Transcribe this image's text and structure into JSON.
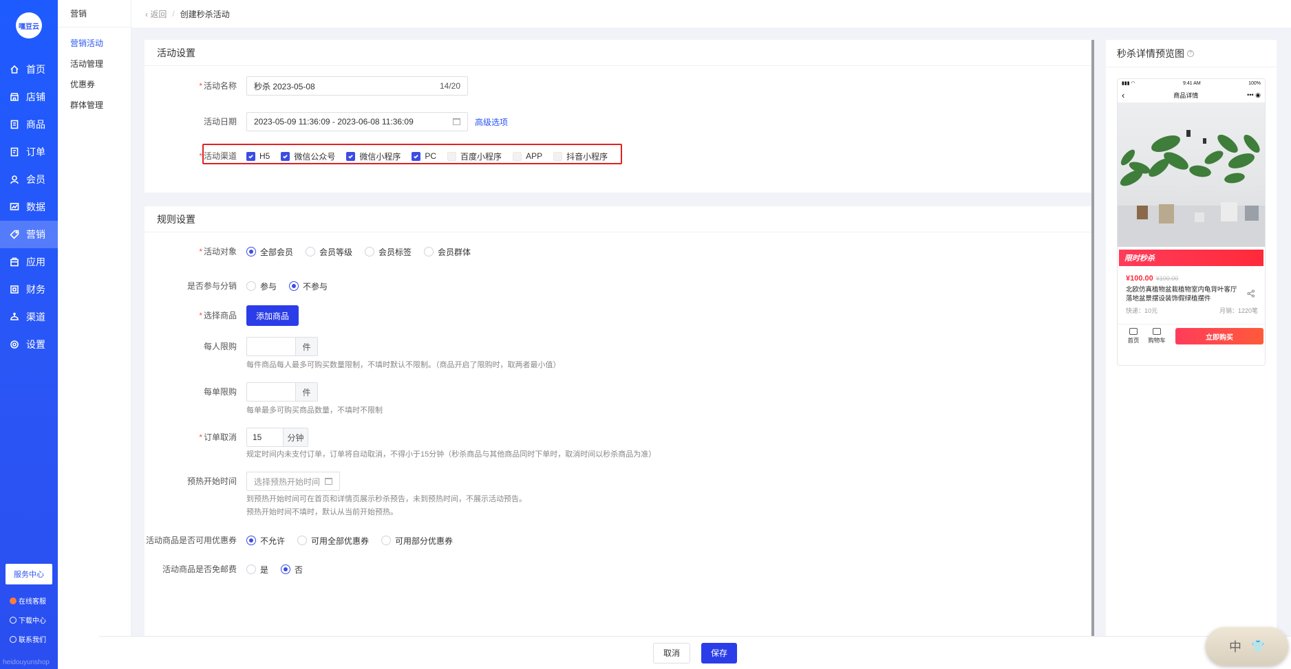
{
  "nav": {
    "logo": "嘿豆云",
    "items": [
      {
        "label": "首页",
        "icon": "home-icon"
      },
      {
        "label": "店铺",
        "icon": "store-icon"
      },
      {
        "label": "商品",
        "icon": "goods-icon"
      },
      {
        "label": "订单",
        "icon": "order-icon"
      },
      {
        "label": "会员",
        "icon": "member-icon"
      },
      {
        "label": "数据",
        "icon": "chart-icon"
      },
      {
        "label": "营销",
        "icon": "tag-icon"
      },
      {
        "label": "应用",
        "icon": "app-icon"
      },
      {
        "label": "财务",
        "icon": "finance-icon"
      },
      {
        "label": "渠道",
        "icon": "channel-icon"
      },
      {
        "label": "设置",
        "icon": "gear-icon"
      }
    ],
    "service_center": "服务中心",
    "online_service": "在线客服",
    "download_center": "下载中心",
    "contact_us": "联系我们",
    "footer_text": "heidouyunshop"
  },
  "submenu": {
    "title": "营销",
    "items": [
      "营销活动",
      "活动管理",
      "优惠券",
      "群体管理"
    ]
  },
  "breadcrumb": {
    "back": "返回",
    "separator": "/",
    "current": "创建秒杀活动"
  },
  "activity_settings": {
    "title": "活动设置",
    "name_label": "活动名称",
    "name_value": "秒杀  2023-05-08",
    "name_count": "14/20",
    "date_label": "活动日期",
    "date_value": "2023-05-09 11:36:09 - 2023-06-08 11:36:09",
    "advanced_link": "高级选项",
    "channel_label": "活动渠道",
    "channels": [
      {
        "label": "H5",
        "checked": true
      },
      {
        "label": "微信公众号",
        "checked": true
      },
      {
        "label": "微信小程序",
        "checked": true
      },
      {
        "label": "PC",
        "checked": true
      },
      {
        "label": "百度小程序",
        "checked": false
      },
      {
        "label": "APP",
        "checked": false
      },
      {
        "label": "抖音小程序",
        "checked": false
      }
    ]
  },
  "rule_settings": {
    "title": "规则设置",
    "target_label": "活动对象",
    "targets": [
      {
        "label": "全部会员",
        "selected": true
      },
      {
        "label": "会员等级",
        "selected": false
      },
      {
        "label": "会员标签",
        "selected": false
      },
      {
        "label": "会员群体",
        "selected": false
      }
    ],
    "distribution_label": "是否参与分销",
    "distribution_options": [
      {
        "label": "参与",
        "selected": false
      },
      {
        "label": "不参与",
        "selected": true
      }
    ],
    "goods_label": "选择商品",
    "add_goods_button": "添加商品",
    "per_person_label": "每人限购",
    "per_person_value": "",
    "per_person_unit": "件",
    "per_person_hint": "每件商品每人最多可购买数量限制，不填时默认不限制。（商品开启了限购时，取两者最小值）",
    "per_order_label": "每单限购",
    "per_order_value": "",
    "per_order_unit": "件",
    "per_order_hint": "每单最多可购买商品数量，不填时不限制",
    "cancel_label": "订单取消",
    "cancel_value": "15",
    "cancel_unit": "分钟",
    "cancel_hint": "规定时间内未支付订单，订单将自动取消，不得小于15分钟（秒杀商品与其他商品同时下单时，取消时间以秒杀商品为准）",
    "preheat_label": "预热开始时间",
    "preheat_placeholder": "选择预热开始时间",
    "preheat_hint1": "到预热开始时间可在首页和详情页展示秒杀预告，未到预热时间，不展示活动预告。",
    "preheat_hint2": "预热开始时间不填时，默认从当前开始预热。",
    "coupon_label": "活动商品是否可用优惠券",
    "coupon_options": [
      {
        "label": "不允许",
        "selected": true
      },
      {
        "label": "可用全部优惠券",
        "selected": false
      },
      {
        "label": "可用部分优惠券",
        "selected": false
      }
    ],
    "shipping_label": "活动商品是否免邮费",
    "shipping_options": [
      {
        "label": "是",
        "selected": false
      },
      {
        "label": "否",
        "selected": true
      }
    ]
  },
  "preview": {
    "title": "秒杀详情预览图",
    "status_time": "9:41 AM",
    "status_battery": "100%",
    "nav_title": "商品详情",
    "flash_label": "限时秒杀",
    "price": "¥100.00",
    "old_price": "¥100.00",
    "product_name": "北欧仿真植物盆栽植物室内龟背叶客厅落地盆景摆设装饰假绿植摆件",
    "shipping": "快递：10元",
    "sales": "月销：1220笔",
    "tab_home": "首页",
    "tab_cart": "购物车",
    "buy_button": "立即购买"
  },
  "footer": {
    "cancel": "取消",
    "save": "保存"
  },
  "ime": {
    "lang": "中"
  }
}
